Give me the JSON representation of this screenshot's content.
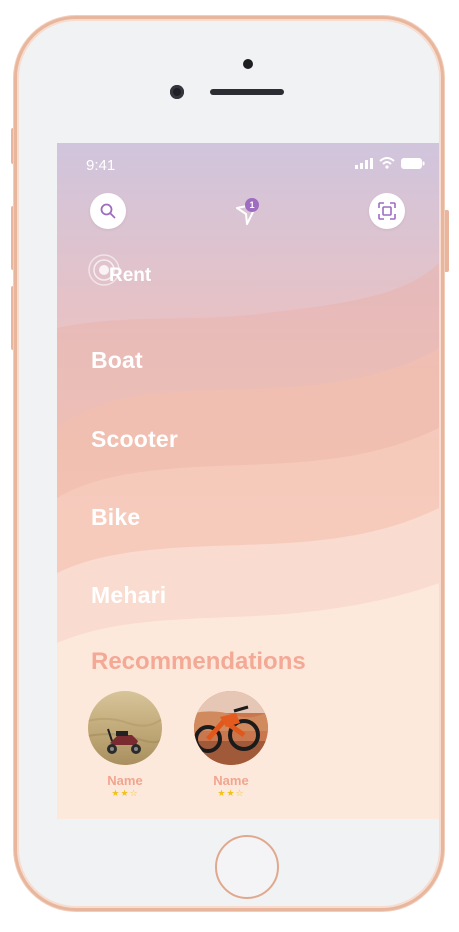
{
  "status": {
    "time": "9:41"
  },
  "header": {
    "search_icon": "search-icon",
    "location_icon": "navigation-arrow-icon",
    "notification_count": "1",
    "scan_icon": "scan-icon"
  },
  "rent": {
    "label": "Rent"
  },
  "categories": [
    {
      "label": "Boat"
    },
    {
      "label": "Scooter"
    },
    {
      "label": "Bike"
    },
    {
      "label": "Mehari"
    }
  ],
  "recommendations": {
    "title": "Recommendations",
    "items": [
      {
        "name": "Name",
        "stars": "★★☆"
      },
      {
        "name": "Name",
        "stars": "★★☆"
      }
    ]
  },
  "colors": {
    "accent": "#9e6cc0",
    "recommendation_text": "#f3a995",
    "star": "#f2c21c"
  }
}
